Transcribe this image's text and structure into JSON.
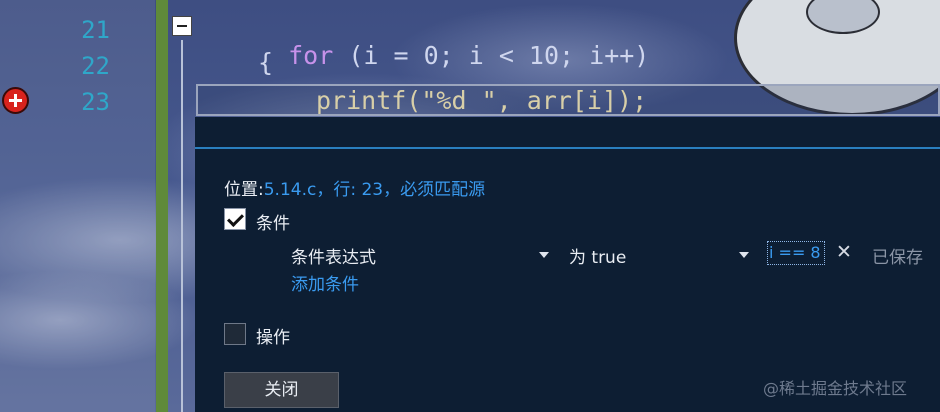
{
  "editor": {
    "line_numbers": [
      "21",
      "22",
      "23"
    ],
    "code_line_21": {
      "keyword": "for",
      "rest": " (i = 0; i < 10; i++)"
    },
    "code_line_22": "{",
    "code_line_23": "printf(\"%d \", arr[i]);"
  },
  "breakpoint_settings": {
    "location_label": "位置:",
    "location_value": "5.14.c，行: 23，必须匹配源",
    "conditions_checkbox_label": "条件",
    "conditions_checked": true,
    "condition_type": "条件表达式",
    "condition_mode": "为 true",
    "condition_value": "i == 8",
    "saved_status": "已保存",
    "add_condition_link": "添加条件",
    "actions_checkbox_label": "操作",
    "actions_checked": false,
    "close_button": "关闭"
  },
  "watermark": "@稀土掘金技术社区",
  "colors": {
    "panel_bg": "#0d1e33",
    "accent": "#3a9bf0",
    "line_number": "#2fa7c9",
    "breakpoint": "#d8231d"
  }
}
